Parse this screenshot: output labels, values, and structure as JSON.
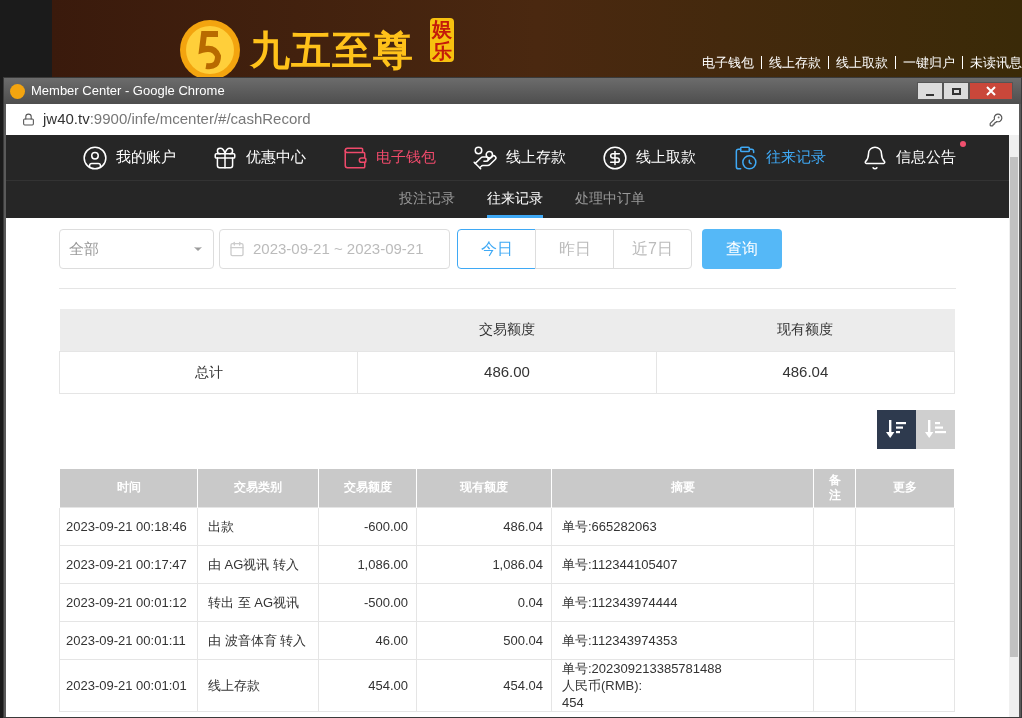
{
  "site": {
    "logo_text": "九五至尊",
    "logo_badge": "娱乐",
    "top_links": [
      "电子钱包",
      "线上存款",
      "线上取款",
      "一键归户",
      "未读讯息"
    ]
  },
  "window": {
    "title": "Member Center - Google Chrome",
    "url_host": "jw40.tv",
    "url_path": ":9900/infe/mcenter/#/cashRecord"
  },
  "nav": [
    {
      "label": "我的账户",
      "selected": false,
      "highlighted": false,
      "badge": false
    },
    {
      "label": "优惠中心",
      "selected": false,
      "highlighted": false,
      "badge": false
    },
    {
      "label": "电子钱包",
      "selected": false,
      "highlighted": true,
      "badge": false
    },
    {
      "label": "线上存款",
      "selected": false,
      "highlighted": false,
      "badge": false
    },
    {
      "label": "线上取款",
      "selected": false,
      "highlighted": false,
      "badge": false
    },
    {
      "label": "往来记录",
      "selected": true,
      "highlighted": false,
      "badge": false
    },
    {
      "label": "信息公告",
      "selected": false,
      "highlighted": false,
      "badge": true
    }
  ],
  "subtabs": [
    {
      "label": "投注记录",
      "selected": false
    },
    {
      "label": "往来记录",
      "selected": true
    },
    {
      "label": "处理中订单",
      "selected": false
    }
  ],
  "filter": {
    "type_select": "全部",
    "date_range": "2023-09-21 ~ 2023-09-21",
    "quick_ranges": [
      {
        "label": "今日",
        "selected": true
      },
      {
        "label": "昨日",
        "selected": false
      },
      {
        "label": "近7日",
        "selected": false
      }
    ],
    "query_button": "查询"
  },
  "summary": {
    "columns": [
      "交易额度",
      "现有额度"
    ],
    "row_label": "总计",
    "values": [
      "486.00",
      "486.04"
    ]
  },
  "sort_buttons": [
    {
      "selected": true
    },
    {
      "selected": false
    }
  ],
  "records": {
    "columns": [
      "时间",
      "交易类别",
      "交易额度",
      "现有额度",
      "摘要",
      "备注",
      "更多"
    ],
    "rows": [
      {
        "time": "2023-09-21 00:18:46",
        "type": "出款",
        "amount": "-600.00",
        "balance": "486.04",
        "summary": [
          "单号:665282063"
        ]
      },
      {
        "time": "2023-09-21 00:17:47",
        "type": "由 AG视讯 转入",
        "amount": "1,086.00",
        "balance": "1,086.04",
        "summary": [
          "单号:112344105407"
        ]
      },
      {
        "time": "2023-09-21 00:01:12",
        "type": "转出 至 AG视讯",
        "amount": "-500.00",
        "balance": "0.04",
        "summary": [
          "单号:112343974444"
        ]
      },
      {
        "time": "2023-09-21 00:01:11",
        "type": "由 波音体育 转入",
        "amount": "46.00",
        "balance": "500.04",
        "summary": [
          "单号:112343974353"
        ]
      },
      {
        "time": "2023-09-21 00:01:01",
        "type": "线上存款",
        "amount": "454.00",
        "balance": "454.04",
        "summary": [
          "单号:202309213385781488",
          "人民币(RMB):",
          "454"
        ]
      }
    ]
  }
}
